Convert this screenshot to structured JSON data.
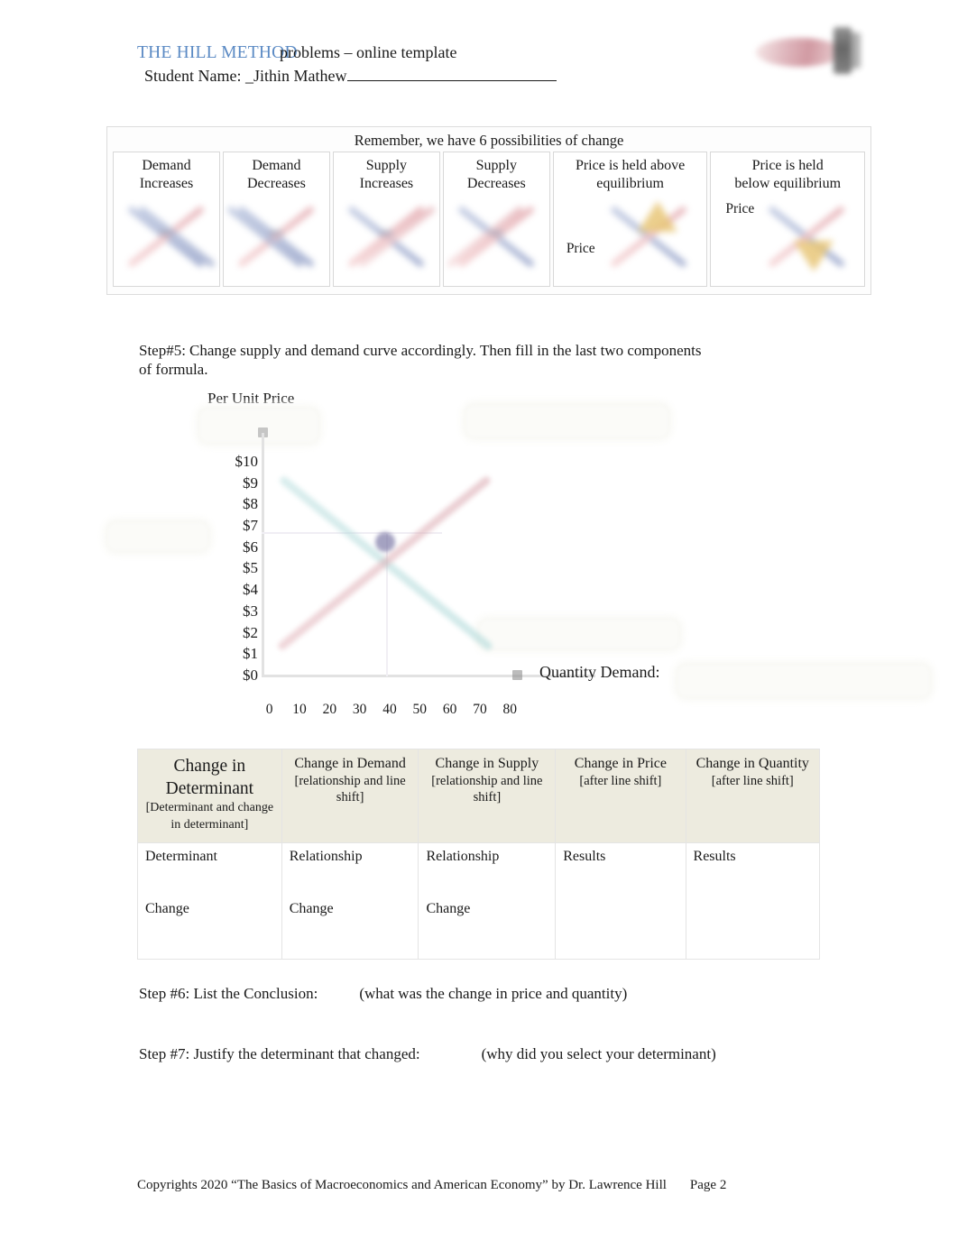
{
  "header": {
    "title_blue": "THE HILL METHOD",
    "title_black": "problems – online template",
    "student_label": "Student Name:  _Jithin Mathew",
    "logo_name": "course-logo"
  },
  "possibilities": {
    "title": "Remember, we have 6 possibilities of change",
    "cells": [
      {
        "line1": "Demand",
        "line2": "Increases",
        "price_label": ""
      },
      {
        "line1": "Demand",
        "line2": "Decreases",
        "price_label": ""
      },
      {
        "line1": "Supply",
        "line2": "Increases",
        "price_label": ""
      },
      {
        "line1": "Supply",
        "line2": "Decreases",
        "price_label": ""
      },
      {
        "line1": "Price is held above",
        "line2": "equilibrium",
        "price_label": "Price"
      },
      {
        "line1": "Price is held",
        "line2": "below equilibrium",
        "price_label": "Price"
      }
    ]
  },
  "step5": {
    "label": "Step#5:",
    "text": "Change supply and demand curve accordingly. Then fill in the last two components of formula."
  },
  "chart_data": {
    "type": "line",
    "title": "Per Unit Price",
    "xlabel": "",
    "ylabel": "Per Unit Price",
    "ylim": [
      0,
      10
    ],
    "xlim": [
      0,
      80
    ],
    "grid": true,
    "legend": "none",
    "ytick_labels": [
      "$10",
      "$9",
      "$8",
      "$7",
      "$6",
      "$5",
      "$4",
      "$3",
      "$2",
      "$1",
      "$0"
    ],
    "xtick_labels": [
      "0",
      "10",
      "20",
      "30",
      "40",
      "50",
      "60",
      "70",
      "80"
    ],
    "yticks": [
      10,
      9,
      8,
      7,
      6,
      5,
      4,
      3,
      2,
      1,
      0
    ],
    "xticks": [
      0,
      10,
      20,
      30,
      40,
      50,
      60,
      70,
      80
    ],
    "series": [
      {
        "name": "Demand",
        "color": "#a9d6d6",
        "x": [
          8,
          62
        ],
        "y": [
          10.4,
          1.4
        ]
      },
      {
        "name": "Supply",
        "color": "#d9a6ae",
        "x": [
          10,
          60
        ],
        "y": [
          1.8,
          10.6
        ]
      }
    ],
    "annotations": [
      {
        "label": "equilibrium-point",
        "x": 35,
        "y": 6.5
      }
    ],
    "quantity_demand_label": "Quantity Demand:"
  },
  "determinant_table": {
    "headers": [
      {
        "main": "Change in Determinant",
        "sub": "[Determinant and change in determinant]"
      },
      {
        "main": "Change in Demand",
        "sub": "[relationship and line shift]"
      },
      {
        "main": "Change in Supply",
        "sub": "[relationship and line shift]"
      },
      {
        "main": "Change in Price",
        "sub": "[after line shift]"
      },
      {
        "main": "Change in Quantity",
        "sub": "[after line shift]"
      }
    ],
    "row": [
      {
        "top": "Determinant",
        "bottom": "Change"
      },
      {
        "top": "Relationship",
        "bottom": "Change"
      },
      {
        "top": "Relationship",
        "bottom": "Change"
      },
      {
        "top": "Results",
        "bottom": ""
      },
      {
        "top": "Results",
        "bottom": ""
      }
    ]
  },
  "step6": {
    "label": "Step #6: List the Conclusion:",
    "hint": "(what was the change in price and quantity)"
  },
  "step7": {
    "label": "Step #7: Justify the determinant that changed:",
    "hint": "(why did you select your determinant)"
  },
  "footer": {
    "text": "Copyrights 2020  “The Basics of Macroeconomics and American Economy” by Dr. Lawrence Hill",
    "page": "Page  2"
  }
}
